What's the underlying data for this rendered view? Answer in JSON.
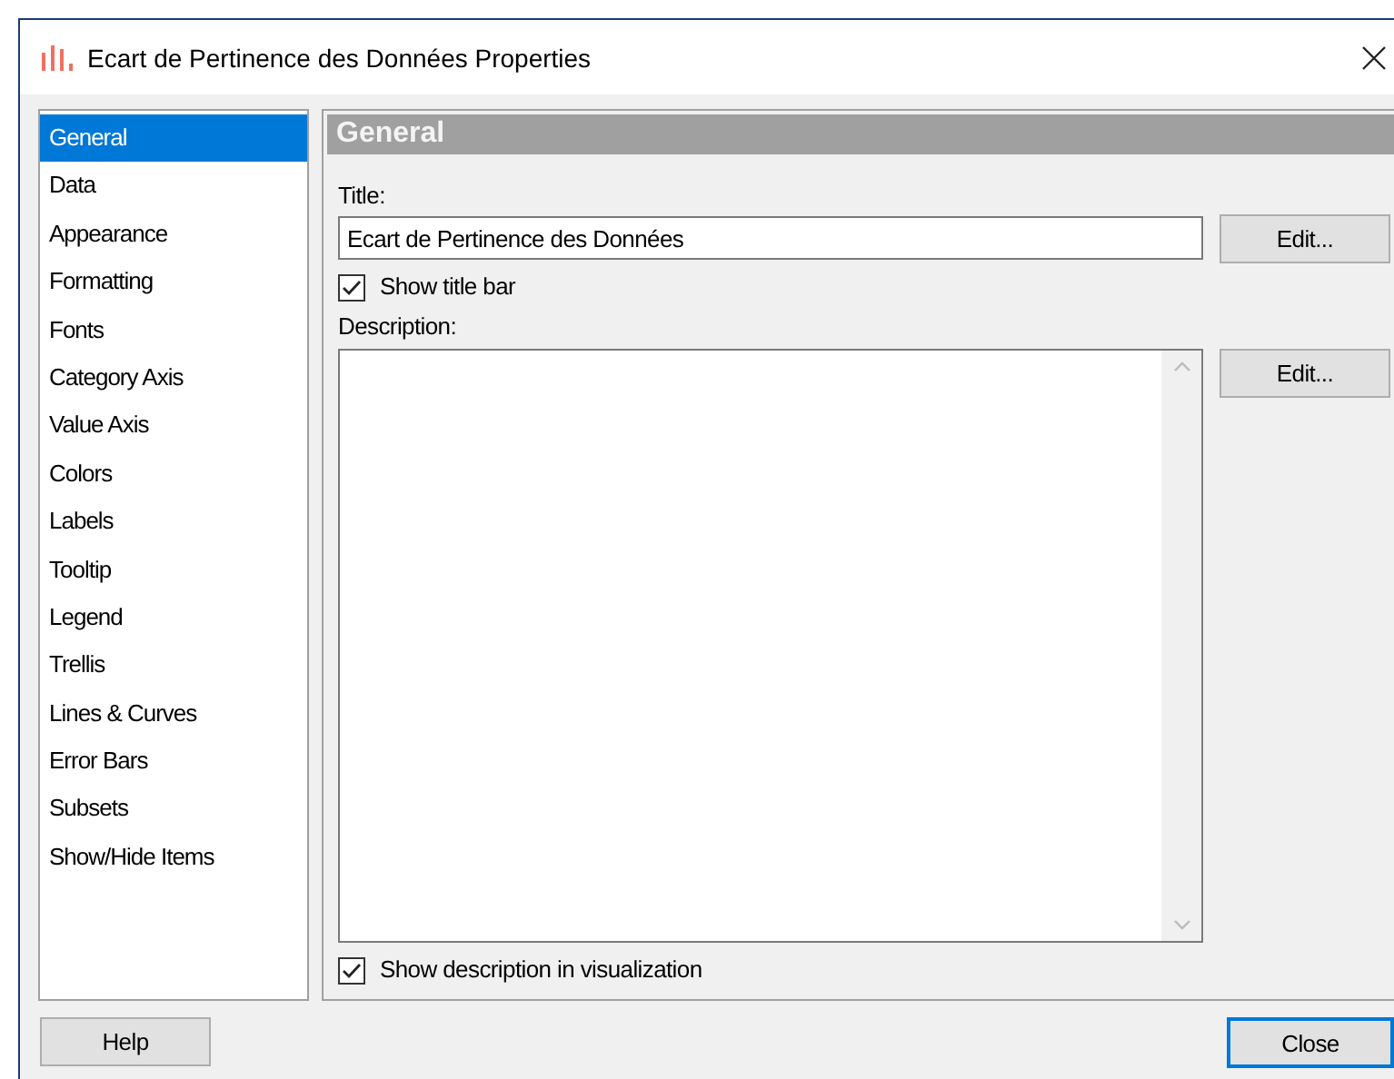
{
  "window": {
    "title": "Ecart de Pertinence des Données Properties"
  },
  "sidebar": {
    "items": [
      {
        "label": "General",
        "selected": true
      },
      {
        "label": "Data",
        "selected": false
      },
      {
        "label": "Appearance",
        "selected": false
      },
      {
        "label": "Formatting",
        "selected": false
      },
      {
        "label": "Fonts",
        "selected": false
      },
      {
        "label": "Category Axis",
        "selected": false
      },
      {
        "label": "Value Axis",
        "selected": false
      },
      {
        "label": "Colors",
        "selected": false
      },
      {
        "label": "Labels",
        "selected": false
      },
      {
        "label": "Tooltip",
        "selected": false
      },
      {
        "label": "Legend",
        "selected": false
      },
      {
        "label": "Trellis",
        "selected": false
      },
      {
        "label": "Lines & Curves",
        "selected": false
      },
      {
        "label": "Error Bars",
        "selected": false
      },
      {
        "label": "Subsets",
        "selected": false
      },
      {
        "label": "Show/Hide Items",
        "selected": false
      }
    ]
  },
  "panel": {
    "header": "General",
    "title_label": "Title:",
    "title_value": "Ecart de Pertinence des Données",
    "title_edit": "Edit...",
    "show_title_bar": {
      "label": "Show title bar",
      "checked": true
    },
    "description_label": "Description:",
    "description_edit": "Edit...",
    "show_description": {
      "label": "Show description in visualization",
      "checked": true
    }
  },
  "buttons": {
    "help": "Help",
    "close": "Close"
  }
}
